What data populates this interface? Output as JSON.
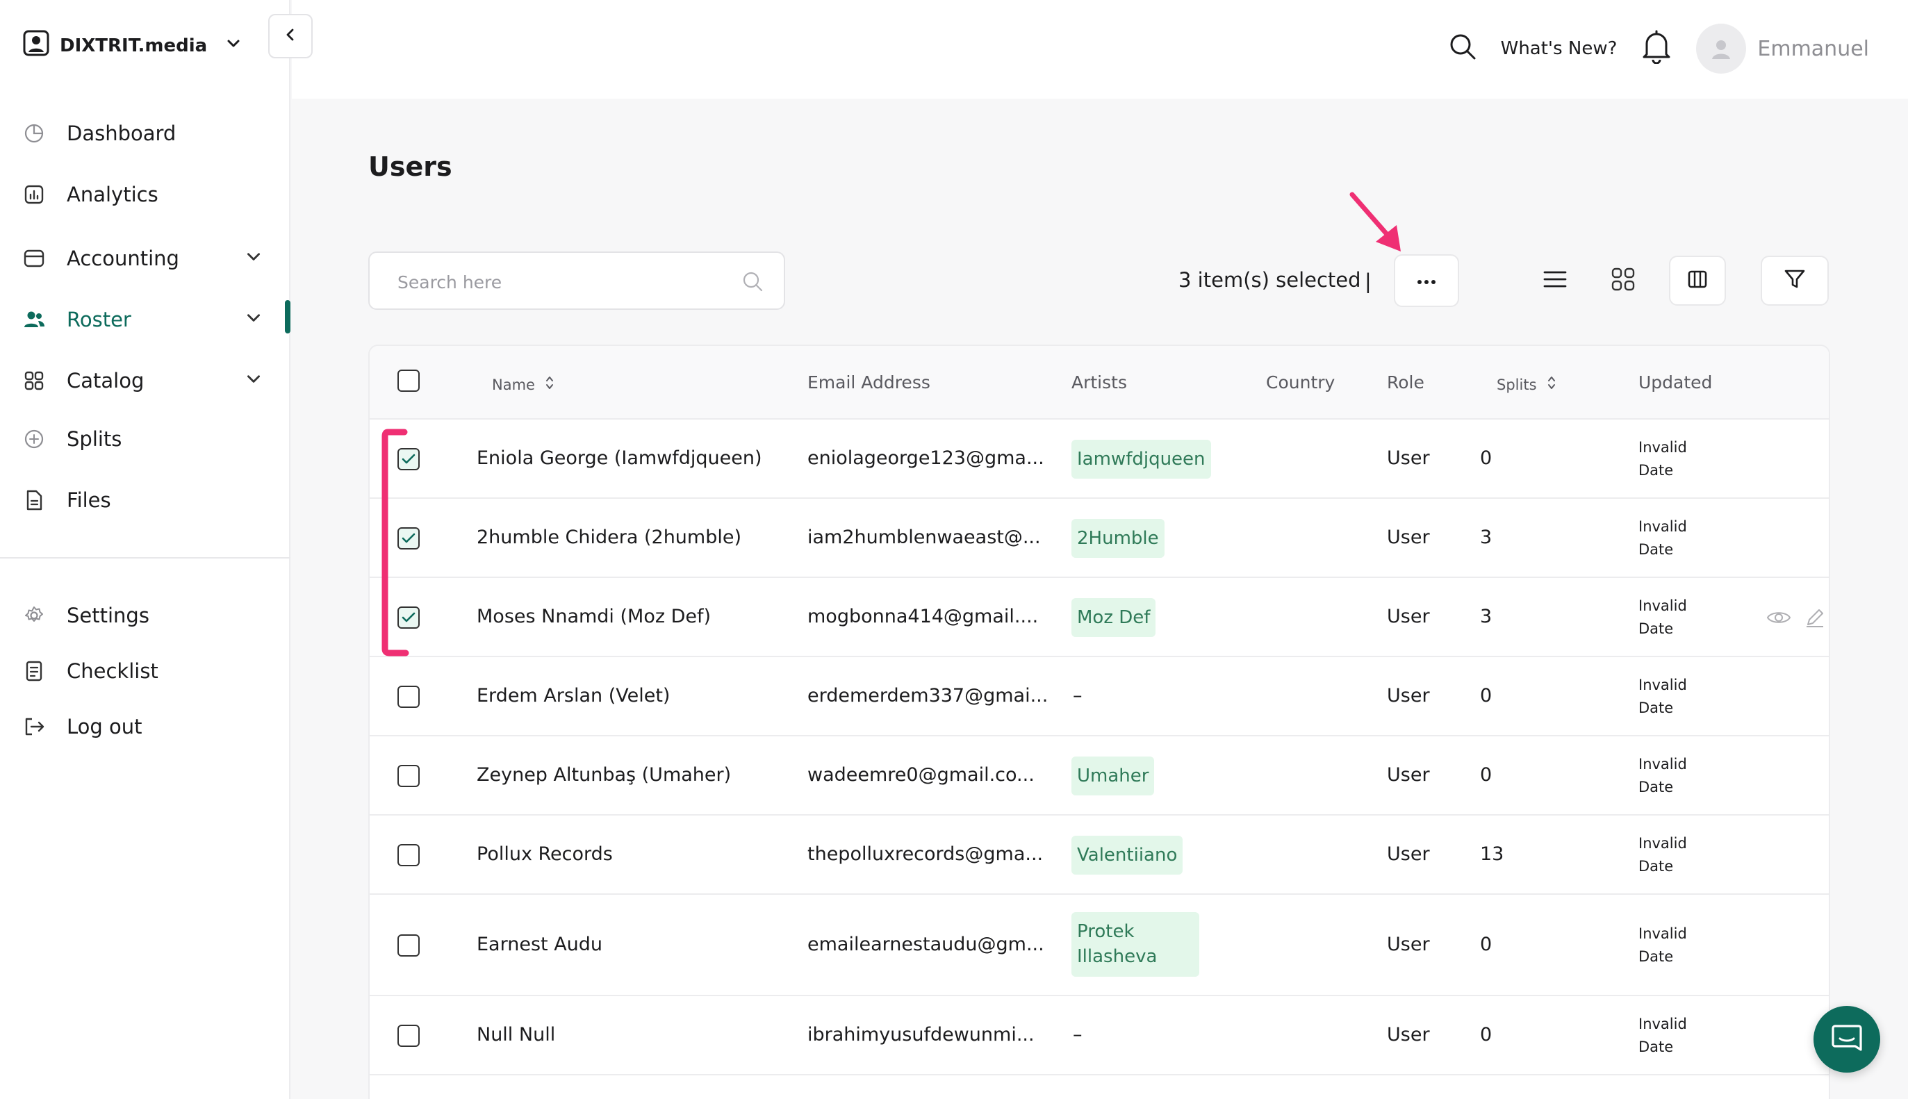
{
  "workspace": {
    "name": "DIXTRIT.media"
  },
  "sidebar": {
    "items": [
      {
        "label": "Dashboard",
        "icon": "pie-chart-icon"
      },
      {
        "label": "Analytics",
        "icon": "bar-chart-icon"
      },
      {
        "label": "Accounting",
        "icon": "wallet-icon",
        "expandable": true
      },
      {
        "label": "Roster",
        "icon": "users-icon",
        "expandable": true,
        "active": true
      },
      {
        "label": "Catalog",
        "icon": "grid-icon",
        "expandable": true
      },
      {
        "label": "Splits",
        "icon": "splits-icon"
      },
      {
        "label": "Files",
        "icon": "file-icon"
      }
    ],
    "bottom_items": [
      {
        "label": "Settings",
        "icon": "gear-icon"
      },
      {
        "label": "Checklist",
        "icon": "checklist-icon"
      },
      {
        "label": "Log out",
        "icon": "logout-icon"
      }
    ]
  },
  "header": {
    "whats_new": "What's New?",
    "user_name": "Emmanuel"
  },
  "page": {
    "title": "Users",
    "search_placeholder": "Search here",
    "selected_text": "3 item(s) selected",
    "separator": "|"
  },
  "table": {
    "columns": {
      "name": "Name",
      "email": "Email Address",
      "artists": "Artists",
      "country": "Country",
      "role": "Role",
      "splits": "Splits",
      "updated": "Updated"
    },
    "rows": [
      {
        "checked": true,
        "name": "Eniola George (Iamwfdjqueen)",
        "email": "eniolageorge123@gma...",
        "artists": [
          "Iamwfdjqueen"
        ],
        "country": "",
        "role": "User",
        "splits": "0",
        "updated": [
          "Invalid",
          "Date"
        ]
      },
      {
        "checked": true,
        "name": "2humble Chidera (2humble)",
        "email": "iam2humblenwaeast@...",
        "artists": [
          "2Humble"
        ],
        "country": "",
        "role": "User",
        "splits": "3",
        "updated": [
          "Invalid",
          "Date"
        ]
      },
      {
        "checked": true,
        "name": "Moses Nnamdi (Moz Def)",
        "email": "mogbonna414@gmail....",
        "artists": [
          "Moz Def"
        ],
        "country": "",
        "role": "User",
        "splits": "3",
        "updated": [
          "Invalid",
          "Date"
        ],
        "hover_actions": true
      },
      {
        "checked": false,
        "name": "Erdem Arslan (Velet)",
        "email": "erdemerdem337@gmai...",
        "artists": [],
        "artists_empty": "–",
        "country": "",
        "role": "User",
        "splits": "0",
        "updated": [
          "Invalid",
          "Date"
        ]
      },
      {
        "checked": false,
        "name": "Zeynep Altunbaş (Umaher)",
        "email": "wadeemre0@gmail.co...",
        "artists": [
          "Umaher"
        ],
        "country": "",
        "role": "User",
        "splits": "0",
        "updated": [
          "Invalid",
          "Date"
        ]
      },
      {
        "checked": false,
        "name": "Pollux Records",
        "email": "thepolluxrecords@gma...",
        "artists": [
          "Valentiiano"
        ],
        "country": "",
        "role": "User",
        "splits": "13",
        "updated": [
          "Invalid",
          "Date"
        ]
      },
      {
        "checked": false,
        "name": "Earnest Audu",
        "email": "emailearnestaudu@gm...",
        "artists": [
          "Protek",
          "Illasheva"
        ],
        "country": "",
        "role": "User",
        "splits": "0",
        "updated": [
          "Invalid",
          "Date"
        ]
      },
      {
        "checked": false,
        "name": "Null Null",
        "email": "ibrahimyusufdewunmi...",
        "artists": [],
        "artists_empty": "–",
        "country": "",
        "role": "User",
        "splits": "0",
        "updated": [
          "Invalid",
          "Date"
        ]
      }
    ]
  },
  "colors": {
    "accent": "#0d6b5c",
    "pill_bg": "#e3f7ea",
    "pill_text": "#2f7a58",
    "annotation": "#ef2f73"
  }
}
